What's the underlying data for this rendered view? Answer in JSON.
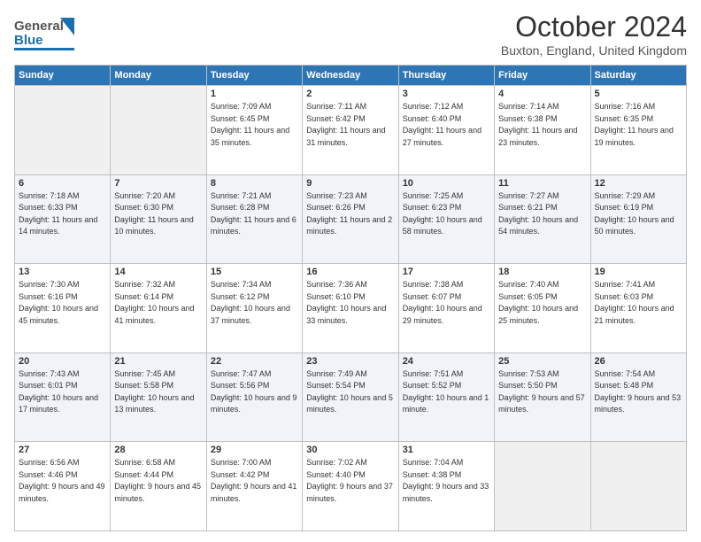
{
  "header": {
    "logo_general": "General",
    "logo_blue": "Blue",
    "month_title": "October 2024",
    "location": "Buxton, England, United Kingdom"
  },
  "weekdays": [
    "Sunday",
    "Monday",
    "Tuesday",
    "Wednesday",
    "Thursday",
    "Friday",
    "Saturday"
  ],
  "weeks": [
    [
      {
        "day": "",
        "sunrise": "",
        "sunset": "",
        "daylight": ""
      },
      {
        "day": "",
        "sunrise": "",
        "sunset": "",
        "daylight": ""
      },
      {
        "day": "1",
        "sunrise": "Sunrise: 7:09 AM",
        "sunset": "Sunset: 6:45 PM",
        "daylight": "Daylight: 11 hours and 35 minutes."
      },
      {
        "day": "2",
        "sunrise": "Sunrise: 7:11 AM",
        "sunset": "Sunset: 6:42 PM",
        "daylight": "Daylight: 11 hours and 31 minutes."
      },
      {
        "day": "3",
        "sunrise": "Sunrise: 7:12 AM",
        "sunset": "Sunset: 6:40 PM",
        "daylight": "Daylight: 11 hours and 27 minutes."
      },
      {
        "day": "4",
        "sunrise": "Sunrise: 7:14 AM",
        "sunset": "Sunset: 6:38 PM",
        "daylight": "Daylight: 11 hours and 23 minutes."
      },
      {
        "day": "5",
        "sunrise": "Sunrise: 7:16 AM",
        "sunset": "Sunset: 6:35 PM",
        "daylight": "Daylight: 11 hours and 19 minutes."
      }
    ],
    [
      {
        "day": "6",
        "sunrise": "Sunrise: 7:18 AM",
        "sunset": "Sunset: 6:33 PM",
        "daylight": "Daylight: 11 hours and 14 minutes."
      },
      {
        "day": "7",
        "sunrise": "Sunrise: 7:20 AM",
        "sunset": "Sunset: 6:30 PM",
        "daylight": "Daylight: 11 hours and 10 minutes."
      },
      {
        "day": "8",
        "sunrise": "Sunrise: 7:21 AM",
        "sunset": "Sunset: 6:28 PM",
        "daylight": "Daylight: 11 hours and 6 minutes."
      },
      {
        "day": "9",
        "sunrise": "Sunrise: 7:23 AM",
        "sunset": "Sunset: 6:26 PM",
        "daylight": "Daylight: 11 hours and 2 minutes."
      },
      {
        "day": "10",
        "sunrise": "Sunrise: 7:25 AM",
        "sunset": "Sunset: 6:23 PM",
        "daylight": "Daylight: 10 hours and 58 minutes."
      },
      {
        "day": "11",
        "sunrise": "Sunrise: 7:27 AM",
        "sunset": "Sunset: 6:21 PM",
        "daylight": "Daylight: 10 hours and 54 minutes."
      },
      {
        "day": "12",
        "sunrise": "Sunrise: 7:29 AM",
        "sunset": "Sunset: 6:19 PM",
        "daylight": "Daylight: 10 hours and 50 minutes."
      }
    ],
    [
      {
        "day": "13",
        "sunrise": "Sunrise: 7:30 AM",
        "sunset": "Sunset: 6:16 PM",
        "daylight": "Daylight: 10 hours and 45 minutes."
      },
      {
        "day": "14",
        "sunrise": "Sunrise: 7:32 AM",
        "sunset": "Sunset: 6:14 PM",
        "daylight": "Daylight: 10 hours and 41 minutes."
      },
      {
        "day": "15",
        "sunrise": "Sunrise: 7:34 AM",
        "sunset": "Sunset: 6:12 PM",
        "daylight": "Daylight: 10 hours and 37 minutes."
      },
      {
        "day": "16",
        "sunrise": "Sunrise: 7:36 AM",
        "sunset": "Sunset: 6:10 PM",
        "daylight": "Daylight: 10 hours and 33 minutes."
      },
      {
        "day": "17",
        "sunrise": "Sunrise: 7:38 AM",
        "sunset": "Sunset: 6:07 PM",
        "daylight": "Daylight: 10 hours and 29 minutes."
      },
      {
        "day": "18",
        "sunrise": "Sunrise: 7:40 AM",
        "sunset": "Sunset: 6:05 PM",
        "daylight": "Daylight: 10 hours and 25 minutes."
      },
      {
        "day": "19",
        "sunrise": "Sunrise: 7:41 AM",
        "sunset": "Sunset: 6:03 PM",
        "daylight": "Daylight: 10 hours and 21 minutes."
      }
    ],
    [
      {
        "day": "20",
        "sunrise": "Sunrise: 7:43 AM",
        "sunset": "Sunset: 6:01 PM",
        "daylight": "Daylight: 10 hours and 17 minutes."
      },
      {
        "day": "21",
        "sunrise": "Sunrise: 7:45 AM",
        "sunset": "Sunset: 5:58 PM",
        "daylight": "Daylight: 10 hours and 13 minutes."
      },
      {
        "day": "22",
        "sunrise": "Sunrise: 7:47 AM",
        "sunset": "Sunset: 5:56 PM",
        "daylight": "Daylight: 10 hours and 9 minutes."
      },
      {
        "day": "23",
        "sunrise": "Sunrise: 7:49 AM",
        "sunset": "Sunset: 5:54 PM",
        "daylight": "Daylight: 10 hours and 5 minutes."
      },
      {
        "day": "24",
        "sunrise": "Sunrise: 7:51 AM",
        "sunset": "Sunset: 5:52 PM",
        "daylight": "Daylight: 10 hours and 1 minute."
      },
      {
        "day": "25",
        "sunrise": "Sunrise: 7:53 AM",
        "sunset": "Sunset: 5:50 PM",
        "daylight": "Daylight: 9 hours and 57 minutes."
      },
      {
        "day": "26",
        "sunrise": "Sunrise: 7:54 AM",
        "sunset": "Sunset: 5:48 PM",
        "daylight": "Daylight: 9 hours and 53 minutes."
      }
    ],
    [
      {
        "day": "27",
        "sunrise": "Sunrise: 6:56 AM",
        "sunset": "Sunset: 4:46 PM",
        "daylight": "Daylight: 9 hours and 49 minutes."
      },
      {
        "day": "28",
        "sunrise": "Sunrise: 6:58 AM",
        "sunset": "Sunset: 4:44 PM",
        "daylight": "Daylight: 9 hours and 45 minutes."
      },
      {
        "day": "29",
        "sunrise": "Sunrise: 7:00 AM",
        "sunset": "Sunset: 4:42 PM",
        "daylight": "Daylight: 9 hours and 41 minutes."
      },
      {
        "day": "30",
        "sunrise": "Sunrise: 7:02 AM",
        "sunset": "Sunset: 4:40 PM",
        "daylight": "Daylight: 9 hours and 37 minutes."
      },
      {
        "day": "31",
        "sunrise": "Sunrise: 7:04 AM",
        "sunset": "Sunset: 4:38 PM",
        "daylight": "Daylight: 9 hours and 33 minutes."
      },
      {
        "day": "",
        "sunrise": "",
        "sunset": "",
        "daylight": ""
      },
      {
        "day": "",
        "sunrise": "",
        "sunset": "",
        "daylight": ""
      }
    ]
  ]
}
